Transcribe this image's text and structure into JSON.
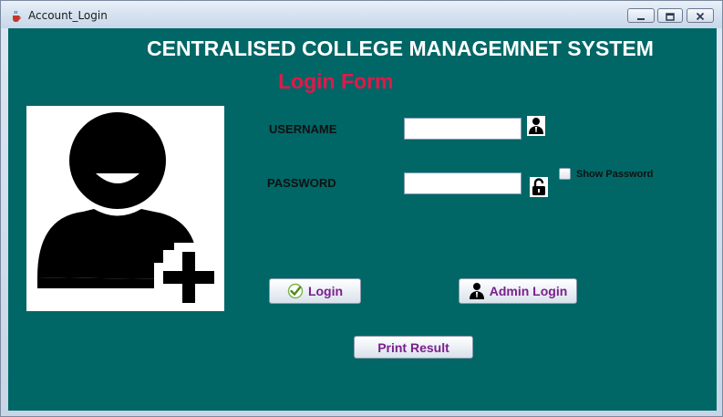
{
  "window": {
    "title": "Account_Login",
    "title_icon": "java-cup-icon",
    "controls": [
      "minimize-icon",
      "maximize-icon",
      "close-icon"
    ]
  },
  "header": {
    "app_title": "CENTRALISED COLLEGE MANAGEMNET SYSTEM",
    "form_title": "Login Form"
  },
  "avatar": {
    "icon": "add-user-icon"
  },
  "form": {
    "username_label": "USERNAME",
    "username_value": "",
    "username_icon": "user-icon",
    "password_label": "PASSWORD",
    "password_value": "",
    "password_icon": "lock-icon",
    "show_password_label": "Show Password",
    "show_password_checked": false
  },
  "buttons": {
    "login_label": "Login",
    "login_icon": "checkmark-icon",
    "admin_login_label": "Admin Login",
    "admin_login_icon": "admin-user-icon",
    "print_result_label": "Print Result"
  },
  "colors": {
    "panel_background": "#006666",
    "app_title": "#ffffff",
    "form_title": "#e0194a",
    "button_text": "#7a1f8c"
  }
}
